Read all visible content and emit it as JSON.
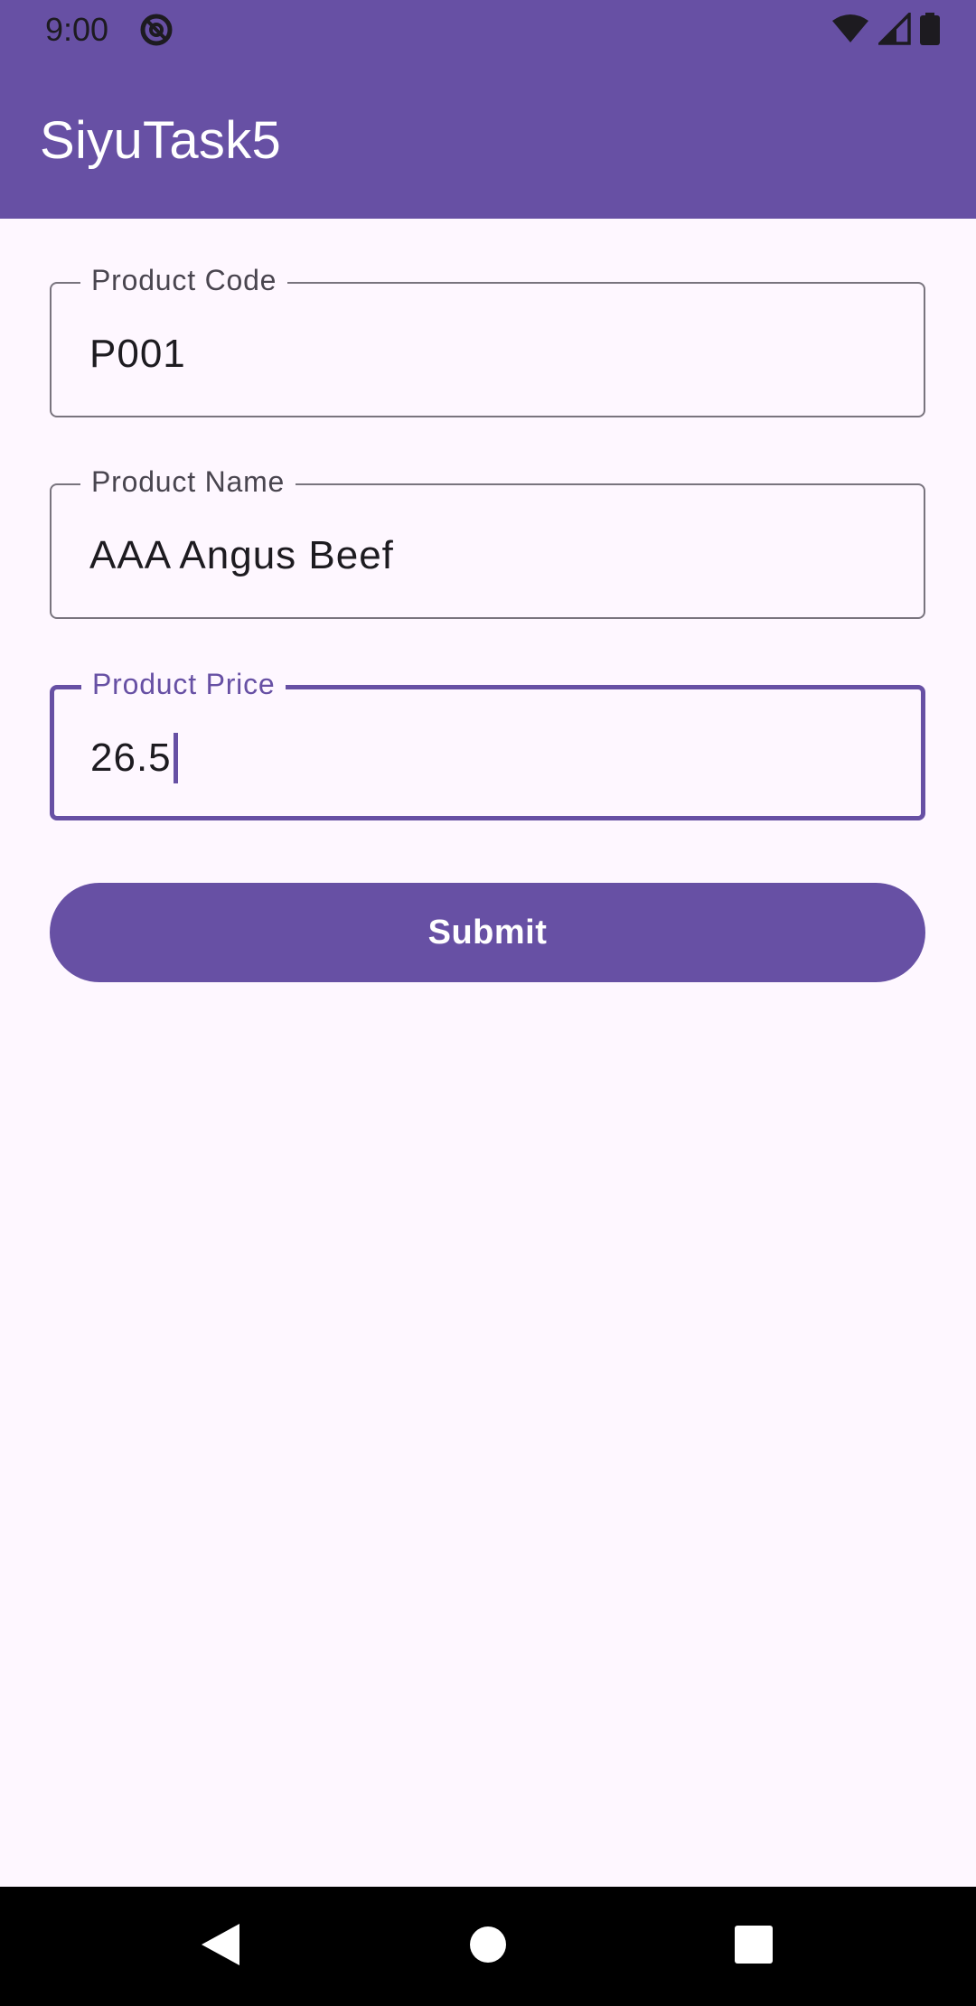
{
  "status_bar": {
    "time": "9:00",
    "icons": [
      "dnd-icon",
      "wifi-icon",
      "signal-icon",
      "battery-icon"
    ]
  },
  "app_bar": {
    "title": "SiyuTask5"
  },
  "form": {
    "product_code": {
      "label": "Product Code",
      "value": "P001"
    },
    "product_name": {
      "label": "Product Name",
      "value": "AAA Angus Beef"
    },
    "product_price": {
      "label": "Product Price",
      "value": "26.5"
    },
    "submit_label": "Submit"
  },
  "nav_bar": {
    "icons": [
      "back-icon",
      "home-icon",
      "recents-icon"
    ]
  },
  "colors": {
    "primary": "#6750A4",
    "background": "#FEF7FF",
    "outline": "#79747E",
    "on_surface": "#1D1B20",
    "label": "#49454F"
  }
}
